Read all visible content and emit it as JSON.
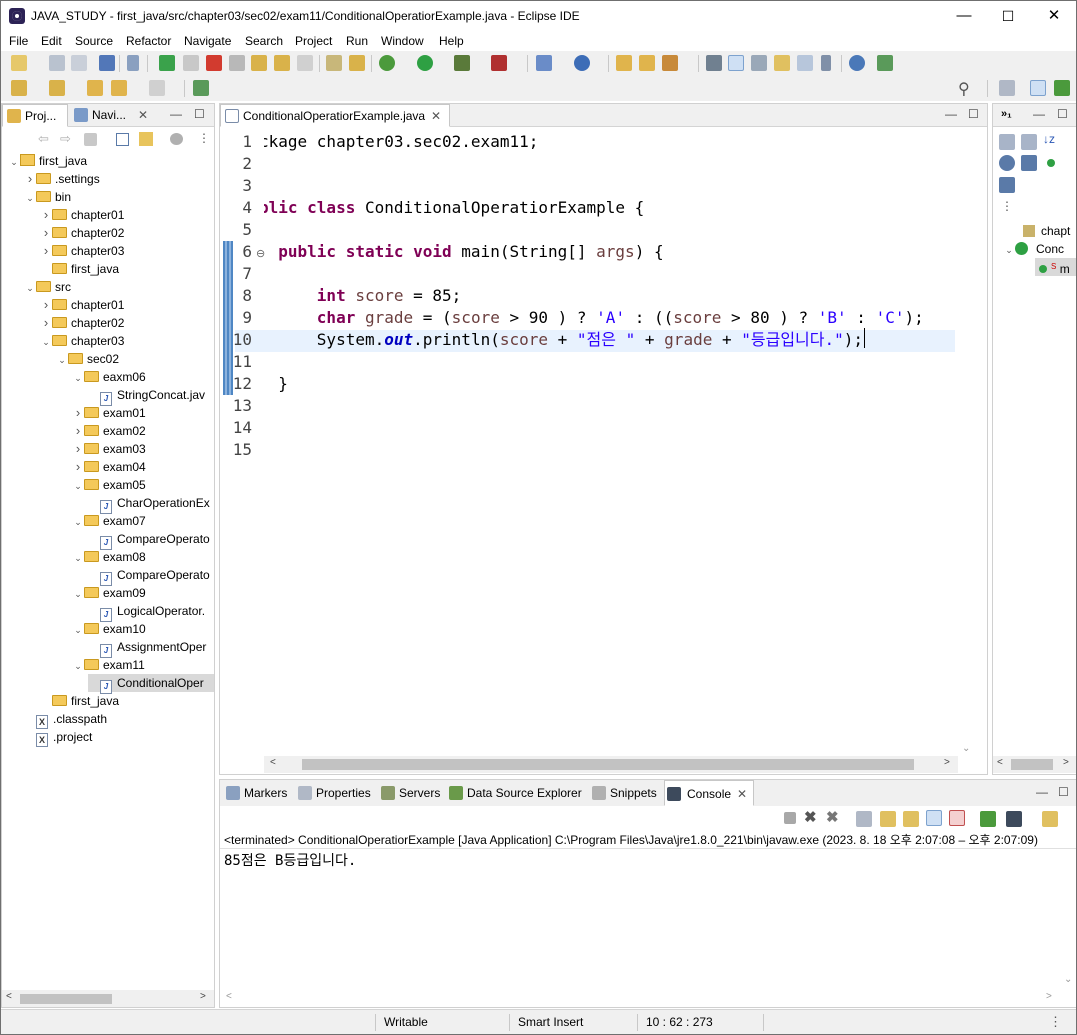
{
  "window": {
    "title": "JAVA_STUDY - first_java/src/chapter03/sec02/exam11/ConditionalOperatiorExample.java - Eclipse IDE",
    "min": "—",
    "max": "☐",
    "close": "✕"
  },
  "menu": [
    "File",
    "Edit",
    "Source",
    "Refactor",
    "Navigate",
    "Search",
    "Project",
    "Run",
    "Window",
    "Help"
  ],
  "left_tabs": {
    "project": "Proj...",
    "navigator": "Navi..."
  },
  "tree": [
    {
      "label": "first_java",
      "type": "project",
      "level": 0,
      "exp": "open"
    },
    {
      "label": ".settings",
      "type": "folder",
      "level": 1,
      "exp": "closed"
    },
    {
      "label": "bin",
      "type": "folder",
      "level": 1,
      "exp": "open"
    },
    {
      "label": "chapter01",
      "type": "folder",
      "level": 2,
      "exp": "closed"
    },
    {
      "label": "chapter02",
      "type": "folder",
      "level": 2,
      "exp": "closed"
    },
    {
      "label": "chapter03",
      "type": "folder",
      "level": 2,
      "exp": "closed"
    },
    {
      "label": "first_java",
      "type": "folder",
      "level": 2,
      "exp": "none"
    },
    {
      "label": "src",
      "type": "folder",
      "level": 1,
      "exp": "open"
    },
    {
      "label": "chapter01",
      "type": "folder",
      "level": 2,
      "exp": "closed"
    },
    {
      "label": "chapter02",
      "type": "folder",
      "level": 2,
      "exp": "closed"
    },
    {
      "label": "chapter03",
      "type": "folder",
      "level": 2,
      "exp": "open"
    },
    {
      "label": "sec02",
      "type": "folder",
      "level": 3,
      "exp": "open"
    },
    {
      "label": "eaxm06",
      "type": "folder",
      "level": 4,
      "exp": "open"
    },
    {
      "label": "StringConcat.jav",
      "type": "java",
      "level": 5,
      "exp": "none"
    },
    {
      "label": "exam01",
      "type": "folder",
      "level": 4,
      "exp": "closed"
    },
    {
      "label": "exam02",
      "type": "folder",
      "level": 4,
      "exp": "closed"
    },
    {
      "label": "exam03",
      "type": "folder",
      "level": 4,
      "exp": "closed"
    },
    {
      "label": "exam04",
      "type": "folder",
      "level": 4,
      "exp": "closed"
    },
    {
      "label": "exam05",
      "type": "folder",
      "level": 4,
      "exp": "open"
    },
    {
      "label": "CharOperationEx",
      "type": "java",
      "level": 5,
      "exp": "none"
    },
    {
      "label": "exam07",
      "type": "folder",
      "level": 4,
      "exp": "open"
    },
    {
      "label": "CompareOperato",
      "type": "java",
      "level": 5,
      "exp": "none"
    },
    {
      "label": "exam08",
      "type": "folder",
      "level": 4,
      "exp": "open"
    },
    {
      "label": "CompareOperato",
      "type": "java",
      "level": 5,
      "exp": "none"
    },
    {
      "label": "exam09",
      "type": "folder",
      "level": 4,
      "exp": "open"
    },
    {
      "label": "LogicalOperator.",
      "type": "java",
      "level": 5,
      "exp": "none"
    },
    {
      "label": "exam10",
      "type": "folder",
      "level": 4,
      "exp": "open"
    },
    {
      "label": "AssignmentOper",
      "type": "java",
      "level": 5,
      "exp": "none"
    },
    {
      "label": "exam11",
      "type": "folder",
      "level": 4,
      "exp": "open"
    },
    {
      "label": "ConditionalOper",
      "type": "java",
      "level": 5,
      "exp": "none",
      "selected": true
    },
    {
      "label": "first_java",
      "type": "folder",
      "level": 2,
      "exp": "none"
    },
    {
      "label": ".classpath",
      "type": "xml",
      "level": 1,
      "exp": "none"
    },
    {
      "label": ".project",
      "type": "xml",
      "level": 1,
      "exp": "none"
    }
  ],
  "editor": {
    "tab": "ConditionalOperatiorExample.java",
    "line_numbers": [
      "1",
      "2",
      "3",
      "4",
      "5",
      "6",
      "7",
      "8",
      "9",
      "10",
      "11",
      "12",
      "13",
      "14",
      "15"
    ],
    "lines": [
      [
        [
          "t",
          "ckage chapter03.sec02.exam11;"
        ]
      ],
      [],
      [],
      [
        [
          "k",
          "blic class"
        ],
        [
          "t",
          " ConditionalOperatiorExample {"
        ]
      ],
      [],
      [
        [
          "t",
          "  "
        ],
        [
          "k",
          "public static void"
        ],
        [
          "t",
          " main(String[] "
        ],
        [
          "v",
          "args"
        ],
        [
          "t",
          ") {"
        ]
      ],
      [],
      [
        [
          "t",
          "      "
        ],
        [
          "k",
          "int"
        ],
        [
          "t",
          " "
        ],
        [
          "v",
          "score"
        ],
        [
          "t",
          " = 85;"
        ]
      ],
      [
        [
          "t",
          "      "
        ],
        [
          "k",
          "char"
        ],
        [
          "t",
          " "
        ],
        [
          "v",
          "grade"
        ],
        [
          "t",
          " = ("
        ],
        [
          "v",
          "score"
        ],
        [
          "t",
          " > 90 ) ? "
        ],
        [
          "s",
          "'A'"
        ],
        [
          "t",
          " : (("
        ],
        [
          "v",
          "score"
        ],
        [
          "t",
          " > 80 ) ? "
        ],
        [
          "s",
          "'B'"
        ],
        [
          "t",
          " : "
        ],
        [
          "s",
          "'C'"
        ],
        [
          "t",
          ");"
        ]
      ],
      [
        [
          "t",
          "      System."
        ],
        [
          "f",
          "out"
        ],
        [
          "t",
          ".println("
        ],
        [
          "v",
          "score"
        ],
        [
          "t",
          " + "
        ],
        [
          "s",
          "\"점은 \""
        ],
        [
          "t",
          " + "
        ],
        [
          "v",
          "grade"
        ],
        [
          "t",
          " + "
        ],
        [
          "s",
          "\"등급입니다.\""
        ],
        [
          "t",
          ");"
        ]
      ],
      [],
      [
        [
          "t",
          "  }"
        ]
      ],
      [],
      [],
      []
    ]
  },
  "outline": {
    "item1": "chapt",
    "item2": "Conc",
    "item3": "m"
  },
  "bottom_tabs": [
    "Markers",
    "Properties",
    "Servers",
    "Data Source Explorer",
    "Snippets",
    "Console"
  ],
  "console": {
    "header": "<terminated> ConditionalOperatiorExample [Java Application] C:\\Program Files\\Java\\jre1.8.0_221\\bin\\javaw.exe  (2023. 8. 18 오후 2:07:08 – 오후 2:07:09)",
    "output": "85점은 B등급입니다."
  },
  "status": {
    "writable": "Writable",
    "insert": "Smart Insert",
    "position": "10 : 62 : 273"
  },
  "colors": {
    "keyword": "#7f0055",
    "string": "#2a00ff",
    "variable": "#6a3e3e",
    "field": "#0000c0",
    "current_line": "#e8f2fe"
  }
}
